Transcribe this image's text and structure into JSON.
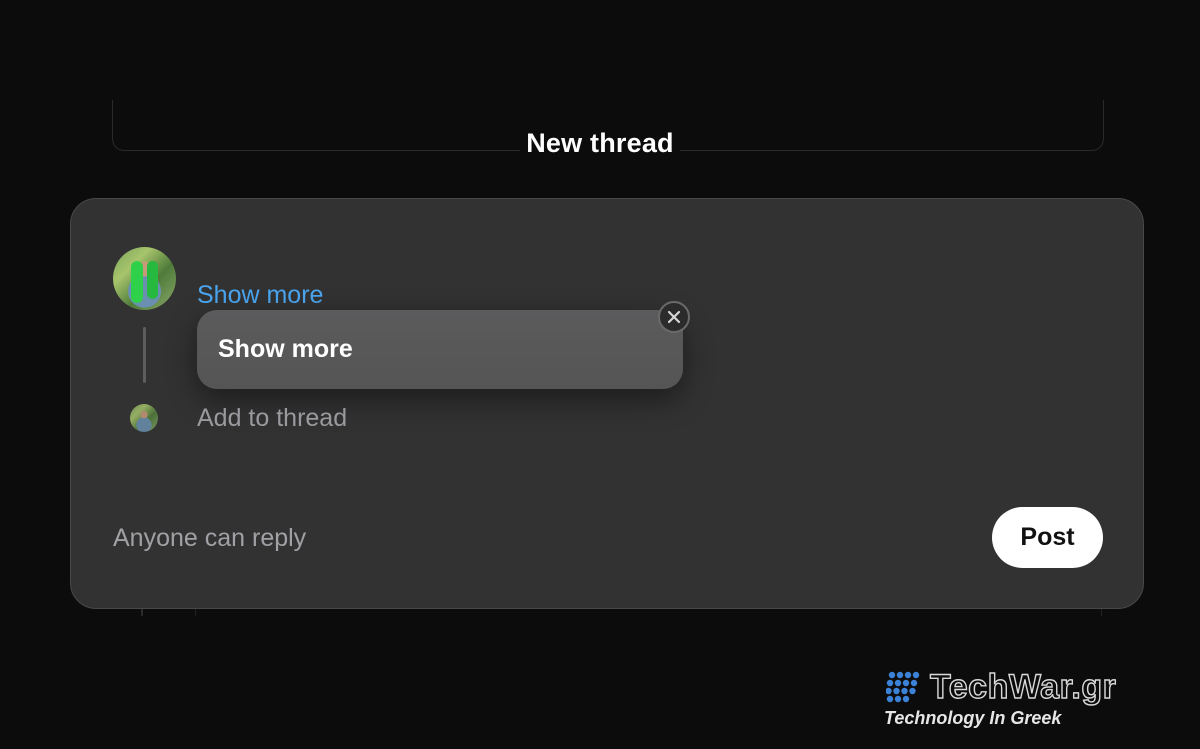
{
  "modal": {
    "title": "New thread"
  },
  "composer": {
    "show_more_link": "Show more",
    "add_to_thread_placeholder": "Add to thread",
    "reply_setting": "Anyone can reply",
    "post_label": "Post"
  },
  "popover": {
    "label": "Show more",
    "close_icon": "close-icon"
  },
  "watermark": {
    "brand": "TechWar.gr",
    "tagline": "Technology In Greek"
  },
  "colors": {
    "background": "#0c0c0d",
    "card": "#323233",
    "link": "#4aa6f0",
    "popover": "#5a5a5b",
    "post_button": "#ffffff"
  }
}
